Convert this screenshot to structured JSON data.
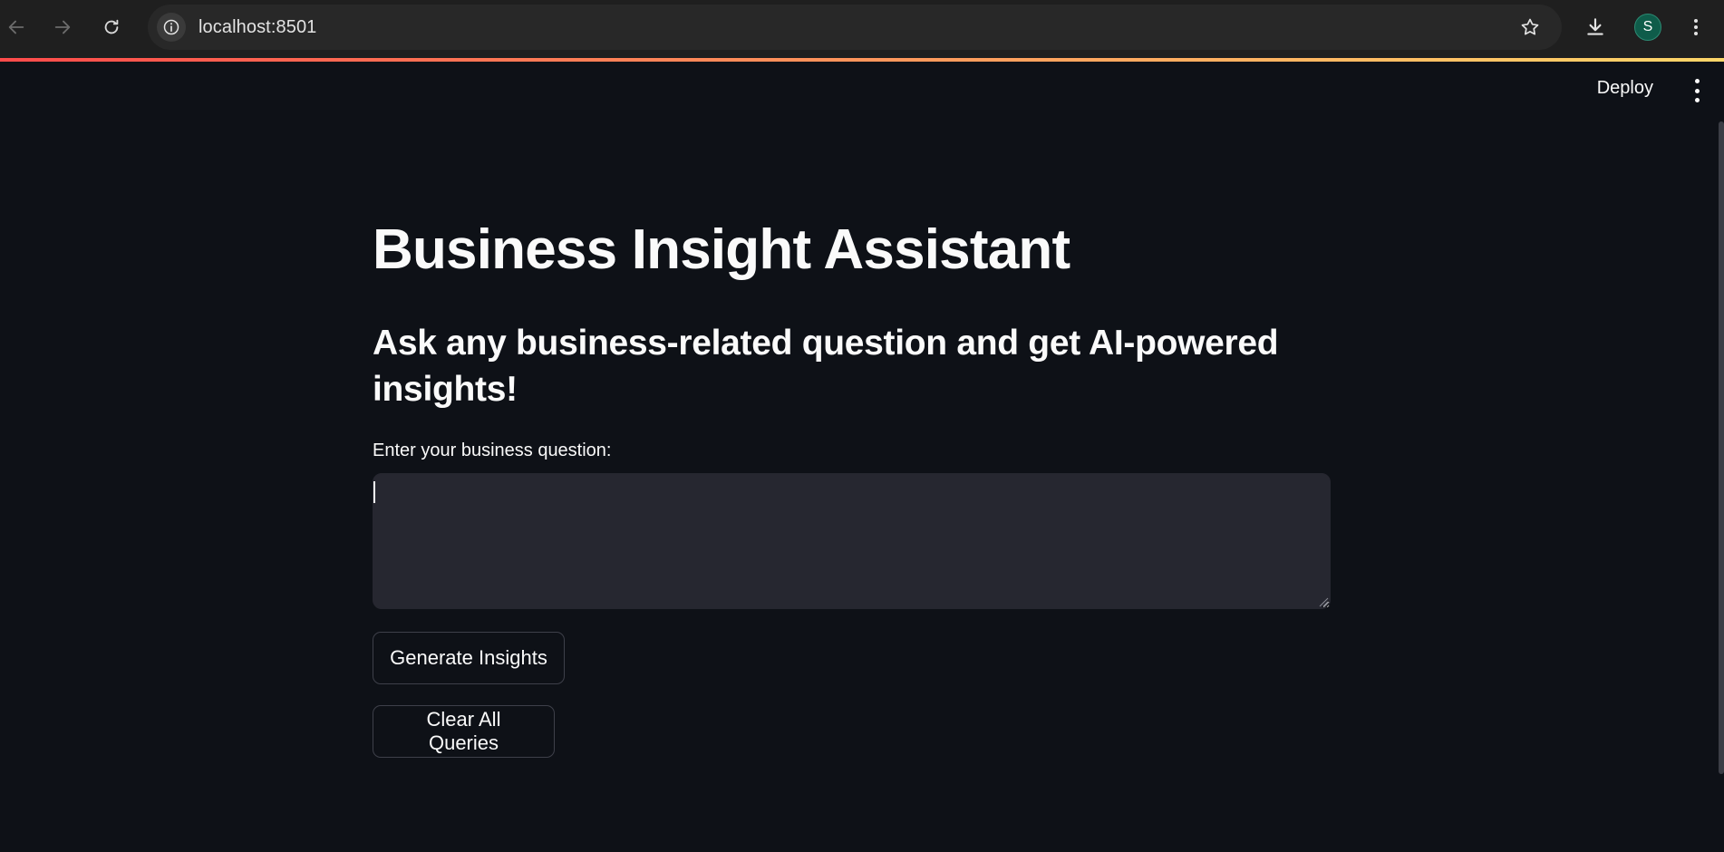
{
  "browser": {
    "url": "localhost:8501",
    "profile_initial": "S",
    "icons": {
      "back": "arrow-left-icon",
      "forward": "arrow-right-icon",
      "reload": "reload-icon",
      "site_info": "info-icon",
      "bookmark": "star-icon",
      "download": "download-icon",
      "menu": "kebab-menu-icon"
    }
  },
  "app": {
    "header": {
      "deploy_label": "Deploy"
    },
    "title": "Business Insight Assistant",
    "subtitle": "Ask any business-related question and get AI-powered insights!",
    "question": {
      "label": "Enter your business question:",
      "value": "",
      "placeholder": ""
    },
    "buttons": {
      "generate_label": "Generate Insights",
      "clear_label": "Clear All Queries"
    }
  },
  "colors": {
    "background": "#0e1117",
    "text": "#fafafa",
    "input_background": "#262730",
    "button_border": "#3e404a",
    "accent_gradient_start": "#ff4b4b",
    "accent_gradient_end": "#fdd669",
    "avatar": "#0f5c4a"
  }
}
